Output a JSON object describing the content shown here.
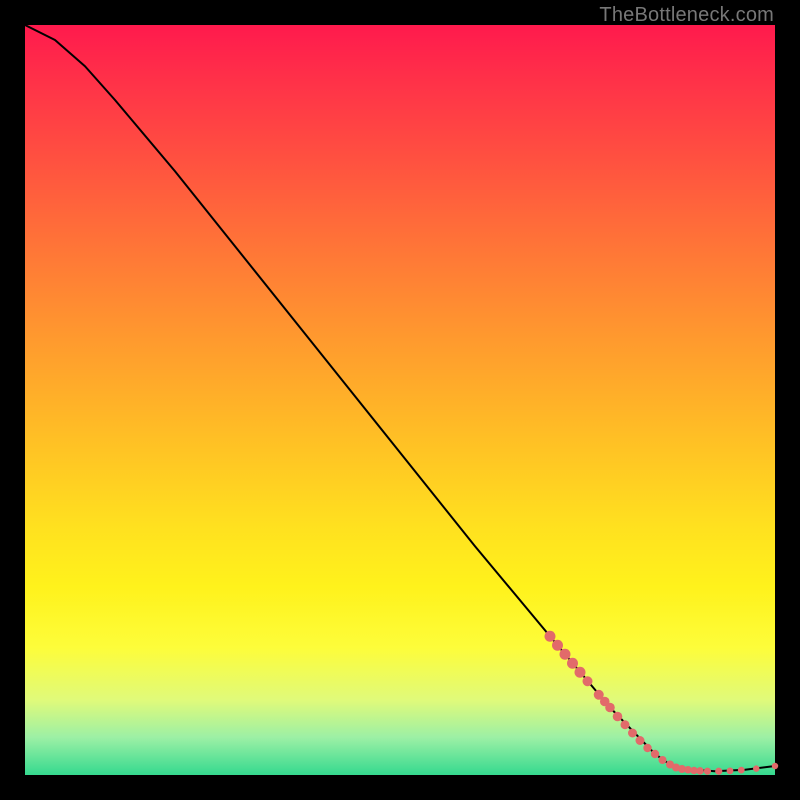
{
  "attribution": "TheBottleneck.com",
  "chart_data": {
    "type": "line",
    "title": "",
    "xlabel": "",
    "ylabel": "",
    "xlim": [
      0,
      100
    ],
    "ylim": [
      0,
      100
    ],
    "curve": {
      "name": "bottleneck-curve",
      "color": "#000000",
      "points": [
        {
          "x": 0,
          "y": 100
        },
        {
          "x": 4,
          "y": 98.0
        },
        {
          "x": 8,
          "y": 94.5
        },
        {
          "x": 12,
          "y": 90.0
        },
        {
          "x": 20,
          "y": 80.5
        },
        {
          "x": 30,
          "y": 68.0
        },
        {
          "x": 40,
          "y": 55.5
        },
        {
          "x": 50,
          "y": 43.0
        },
        {
          "x": 60,
          "y": 30.5
        },
        {
          "x": 70,
          "y": 18.5
        },
        {
          "x": 78,
          "y": 9.0
        },
        {
          "x": 84,
          "y": 2.8
        },
        {
          "x": 86,
          "y": 1.4
        },
        {
          "x": 88,
          "y": 0.8
        },
        {
          "x": 92,
          "y": 0.5
        },
        {
          "x": 96,
          "y": 0.7
        },
        {
          "x": 100,
          "y": 1.2
        }
      ]
    },
    "markers": {
      "name": "highlighted-points",
      "color": "#e26a6a",
      "radius_scale": [
        3.0,
        5.5
      ],
      "points": [
        {
          "x": 70.0,
          "y": 18.5,
          "r": 5.5
        },
        {
          "x": 71.0,
          "y": 17.3,
          "r": 5.5
        },
        {
          "x": 72.0,
          "y": 16.1,
          "r": 5.5
        },
        {
          "x": 73.0,
          "y": 14.9,
          "r": 5.5
        },
        {
          "x": 74.0,
          "y": 13.7,
          "r": 5.5
        },
        {
          "x": 75.0,
          "y": 12.5,
          "r": 5.0
        },
        {
          "x": 76.5,
          "y": 10.7,
          "r": 5.0
        },
        {
          "x": 77.3,
          "y": 9.8,
          "r": 4.8
        },
        {
          "x": 78.0,
          "y": 9.0,
          "r": 4.8
        },
        {
          "x": 79.0,
          "y": 7.8,
          "r": 4.8
        },
        {
          "x": 80.0,
          "y": 6.7,
          "r": 4.5
        },
        {
          "x": 81.0,
          "y": 5.6,
          "r": 4.5
        },
        {
          "x": 82.0,
          "y": 4.6,
          "r": 4.5
        },
        {
          "x": 83.0,
          "y": 3.6,
          "r": 4.2
        },
        {
          "x": 84.0,
          "y": 2.8,
          "r": 4.2
        },
        {
          "x": 85.0,
          "y": 2.0,
          "r": 4.0
        },
        {
          "x": 86.0,
          "y": 1.4,
          "r": 4.0
        },
        {
          "x": 86.8,
          "y": 1.0,
          "r": 4.0
        },
        {
          "x": 87.6,
          "y": 0.8,
          "r": 4.0
        },
        {
          "x": 88.4,
          "y": 0.7,
          "r": 3.8
        },
        {
          "x": 89.2,
          "y": 0.6,
          "r": 3.8
        },
        {
          "x": 90.0,
          "y": 0.55,
          "r": 3.8
        },
        {
          "x": 91.0,
          "y": 0.5,
          "r": 3.6
        },
        {
          "x": 92.5,
          "y": 0.5,
          "r": 3.6
        },
        {
          "x": 94.0,
          "y": 0.55,
          "r": 3.4
        },
        {
          "x": 95.5,
          "y": 0.65,
          "r": 3.4
        },
        {
          "x": 97.5,
          "y": 0.85,
          "r": 3.2
        },
        {
          "x": 100.0,
          "y": 1.2,
          "r": 3.2
        }
      ]
    }
  }
}
